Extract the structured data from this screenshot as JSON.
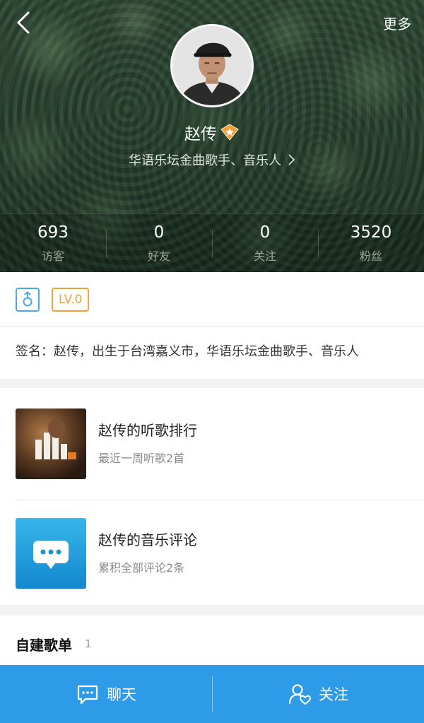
{
  "header": {
    "more_label": "更多",
    "name": "赵传",
    "subtitle": "华语乐坛金曲歌手、音乐人",
    "stats": [
      {
        "value": "693",
        "label": "访客"
      },
      {
        "value": "0",
        "label": "好友"
      },
      {
        "value": "0",
        "label": "关注"
      },
      {
        "value": "3520",
        "label": "粉丝"
      }
    ]
  },
  "profile": {
    "level": "LV.0",
    "signature": "签名：赵传，出生于台湾嘉义市，华语乐坛金曲歌手、音乐人"
  },
  "entries": [
    {
      "title": "赵传的听歌排行",
      "subtitle": "最近一周听歌2首"
    },
    {
      "title": "赵传的音乐评论",
      "subtitle": "累积全部评论2条"
    }
  ],
  "playlists": {
    "title": "自建歌单",
    "count": "1"
  },
  "bottom_bar": {
    "chat_label": "聊天",
    "follow_label": "关注"
  },
  "colors": {
    "accent_blue": "#2d9be8",
    "level_orange": "#f0a23a",
    "gender_blue": "#4aa9e6"
  }
}
